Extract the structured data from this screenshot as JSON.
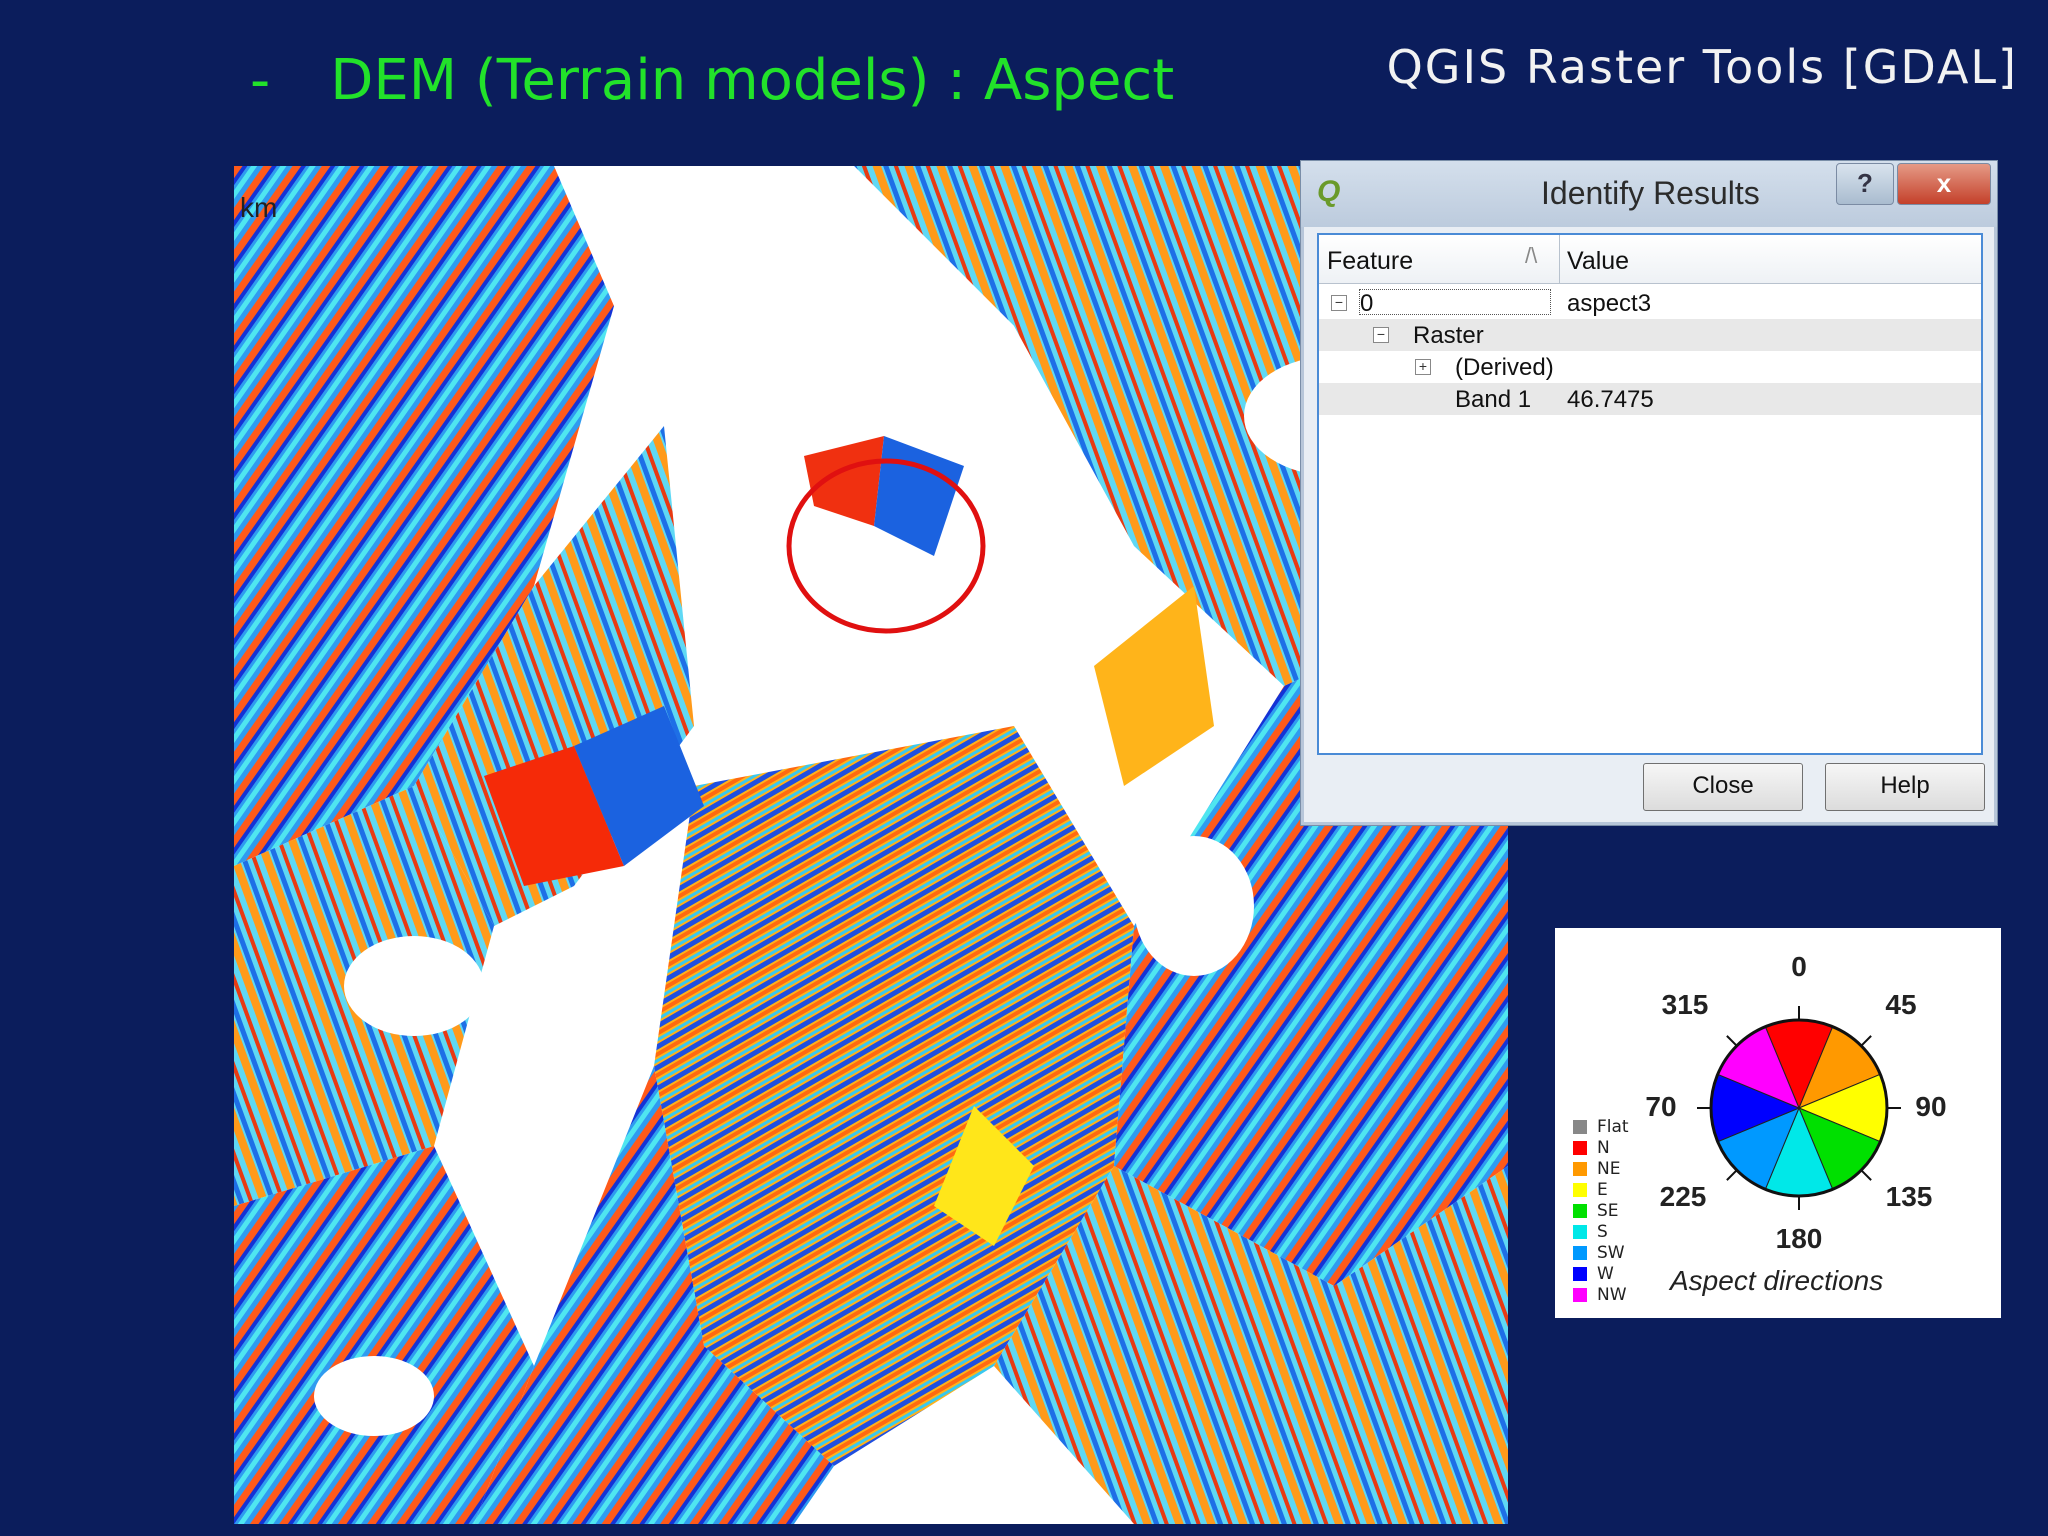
{
  "slide": {
    "dash": "-",
    "title": "DEM (Terrain models) : Aspect",
    "subtitle": "QGIS  Raster  Tools  [GDAL]"
  },
  "map": {
    "unit_label": "km",
    "highlight_color": "#e01010"
  },
  "dialog": {
    "title": "Identify Results",
    "help_glyph": "?",
    "close_glyph": "x",
    "columns": {
      "feature": "Feature",
      "value": "Value"
    },
    "rows": [
      {
        "feature": "0",
        "value": "aspect3"
      },
      {
        "feature": "Raster",
        "value": ""
      },
      {
        "feature": "(Derived)",
        "value": ""
      },
      {
        "feature": "Band 1",
        "value": "46.7475"
      }
    ],
    "buttons": {
      "close": "Close",
      "help": "Help"
    }
  },
  "legend": {
    "caption": "Aspect directions",
    "degree_labels": [
      "0",
      "45",
      "90",
      "135",
      "180",
      "225",
      "70",
      "315"
    ],
    "classes": [
      {
        "label": "Flat",
        "color": "#888888"
      },
      {
        "label": "N",
        "color": "#ff0000"
      },
      {
        "label": "NE",
        "color": "#ff9900"
      },
      {
        "label": "E",
        "color": "#ffff00"
      },
      {
        "label": "SE",
        "color": "#00e000"
      },
      {
        "label": "S",
        "color": "#00e8e8"
      },
      {
        "label": "SW",
        "color": "#0099ff"
      },
      {
        "label": "W",
        "color": "#0000ff"
      },
      {
        "label": "NW",
        "color": "#ff00ff"
      }
    ]
  }
}
